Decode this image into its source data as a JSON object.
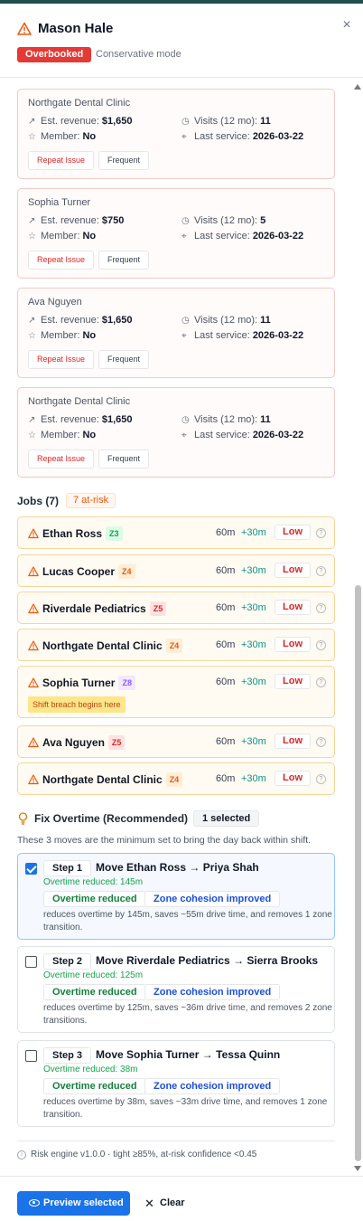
{
  "header": {
    "title": "Mason Hale",
    "status_badge": "Overbooked",
    "mode": "Conservative mode",
    "close_label": "×"
  },
  "customers": [
    {
      "name": "Northgate Dental Clinic",
      "revenue_label": "Est. revenue:",
      "revenue": "$1,650",
      "visits_label": "Visits (12 mo):",
      "visits": "11",
      "member_label": "Member:",
      "member": "No",
      "last_service_label": "Last service:",
      "last_service": "2026-03-22",
      "tags": [
        "Repeat Issue",
        "Frequent"
      ]
    },
    {
      "name": "Sophia Turner",
      "revenue_label": "Est. revenue:",
      "revenue": "$750",
      "visits_label": "Visits (12 mo):",
      "visits": "5",
      "member_label": "Member:",
      "member": "No",
      "last_service_label": "Last service:",
      "last_service": "2026-03-22",
      "tags": [
        "Repeat Issue",
        "Frequent"
      ]
    },
    {
      "name": "Ava Nguyen",
      "revenue_label": "Est. revenue:",
      "revenue": "$1,650",
      "visits_label": "Visits (12 mo):",
      "visits": "11",
      "member_label": "Member:",
      "member": "No",
      "last_service_label": "Last service:",
      "last_service": "2026-03-22",
      "tags": [
        "Repeat Issue",
        "Frequent"
      ]
    },
    {
      "name": "Northgate Dental Clinic",
      "revenue_label": "Est. revenue:",
      "revenue": "$1,650",
      "visits_label": "Visits (12 mo):",
      "visits": "11",
      "member_label": "Member:",
      "member": "No",
      "last_service_label": "Last service:",
      "last_service": "2026-03-22",
      "tags": [
        "Repeat Issue",
        "Frequent"
      ]
    }
  ],
  "jobs": {
    "heading": "Jobs (7)",
    "risk_badge": "7 at-risk",
    "items": [
      {
        "name": "Ethan Ross",
        "zone": "Z3",
        "zone_color": "#16a34a",
        "duration": "60m",
        "extra": "+30m",
        "level": "Low"
      },
      {
        "name": "Lucas Cooper",
        "zone": "Z4",
        "zone_color": "#ea580c",
        "duration": "60m",
        "extra": "+30m",
        "level": "Low"
      },
      {
        "name": "Riverdale Pediatrics",
        "zone": "Z5",
        "zone_color": "#dc2626",
        "duration": "60m",
        "extra": "+30m",
        "level": "Low"
      },
      {
        "name": "Northgate Dental Clinic",
        "zone": "Z4",
        "zone_color": "#ea580c",
        "duration": "60m",
        "extra": "+30m",
        "level": "Low"
      },
      {
        "name": "Sophia Turner",
        "zone": "Z8",
        "zone_color": "#8b5cf6",
        "duration": "60m",
        "extra": "+30m",
        "level": "Low",
        "note": "Shift breach begins here"
      },
      {
        "name": "Ava Nguyen",
        "zone": "Z5",
        "zone_color": "#dc2626",
        "duration": "60m",
        "extra": "+30m",
        "level": "Low"
      },
      {
        "name": "Northgate Dental Clinic",
        "zone": "Z4",
        "zone_color": "#ea580c",
        "duration": "60m",
        "extra": "+30m",
        "level": "Low"
      }
    ]
  },
  "fix": {
    "title": "Fix Overtime (Recommended)",
    "selected_badge": "1 selected",
    "description": "These 3 moves are the minimum set to bring the day back within shift.",
    "steps": [
      {
        "step": "Step 1",
        "title": "Move Ethan Ross → Priya Shah",
        "reduced": "Overtime reduced: 145m",
        "pill1": "Overtime reduced",
        "pill2": "Zone cohesion improved",
        "detail": "reduces overtime by 145m, saves ~55m drive time, and removes 1 zone transition.",
        "checked": true
      },
      {
        "step": "Step 2",
        "title": "Move Riverdale Pediatrics → Sierra Brooks",
        "reduced": "Overtime reduced: 125m",
        "pill1": "Overtime reduced",
        "pill2": "Zone cohesion improved",
        "detail": "reduces overtime by 125m, saves ~36m drive time, and removes 2 zone transitions.",
        "checked": false
      },
      {
        "step": "Step 3",
        "title": "Move Sophia Turner → Tessa Quinn",
        "reduced": "Overtime reduced: 38m",
        "pill1": "Overtime reduced",
        "pill2": "Zone cohesion improved",
        "detail": "reduces overtime by 38m, saves ~33m drive time, and removes 1 zone transition.",
        "checked": false
      }
    ],
    "risk_engine": "Risk engine v1.0.0 · tight ≥85%, at-risk confidence <0.45"
  },
  "footer": {
    "preview_label": "Preview selected",
    "clear_label": "Clear"
  },
  "colors": {
    "accent": "#1a73e8",
    "danger": "#e53935",
    "warning": "#ea580c",
    "success": "#16a34a"
  }
}
